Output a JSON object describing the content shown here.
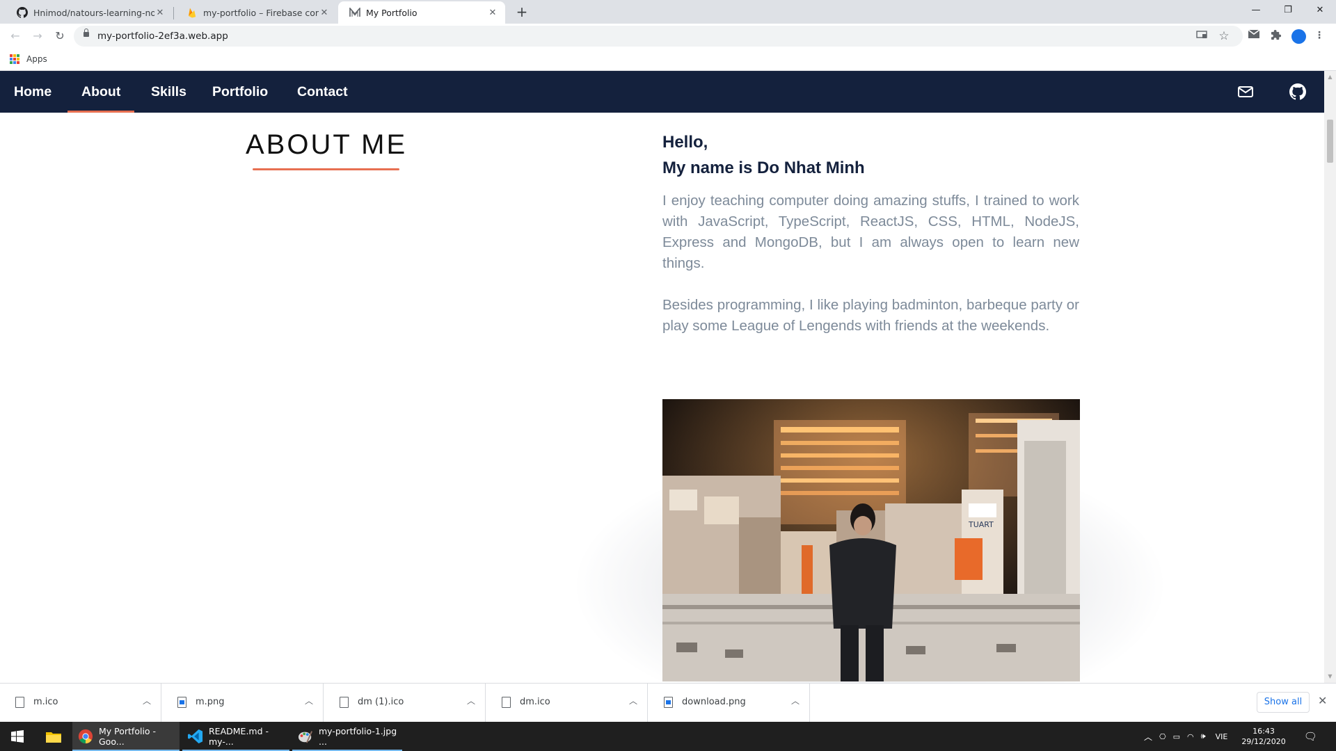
{
  "browser": {
    "tabs": [
      {
        "title": "Hnimod/natours-learning-nodejs",
        "icon": "github-icon"
      },
      {
        "title": "my-portfolio – Firebase console",
        "icon": "firebase-icon"
      },
      {
        "title": "My Portfolio",
        "icon": "portfolio-m-icon",
        "active": true
      }
    ],
    "url": "my-portfolio-2ef3a.web.app",
    "bookmarks_apps": "Apps"
  },
  "site": {
    "nav": [
      "Home",
      "About",
      "Skills",
      "Portfolio",
      "Contact"
    ],
    "active_nav": "About",
    "nav_icons": [
      "mail-icon",
      "github-icon"
    ],
    "section_title": "ABOUT ME",
    "greeting": "Hello,",
    "name_line": "My name is Do Nhat Minh",
    "paragraph1": "I enjoy teaching computer doing amazing stuffs, I trained to work with JavaScript, TypeScript, ReactJS, CSS, HTML, NodeJS, Express and MongoDB, but I am always open to learn new things.",
    "paragraph2": "Besides programming, I like playing badminton, barbeque party or play some League of Lengends with friends at the weekends.",
    "photo_sign": "TUART",
    "accent_color": "#e76f51",
    "nav_bg": "#14213d"
  },
  "downloads": {
    "items": [
      "m.ico",
      "m.png",
      "dm (1).ico",
      "dm.ico",
      "download.png"
    ],
    "show_all": "Show all"
  },
  "taskbar": {
    "apps": [
      "My Portfolio - Goo...",
      "README.md - my-...",
      "my-portfolio-1.jpg ..."
    ],
    "language": "VIE",
    "time": "16:43",
    "date": "29/12/2020"
  }
}
